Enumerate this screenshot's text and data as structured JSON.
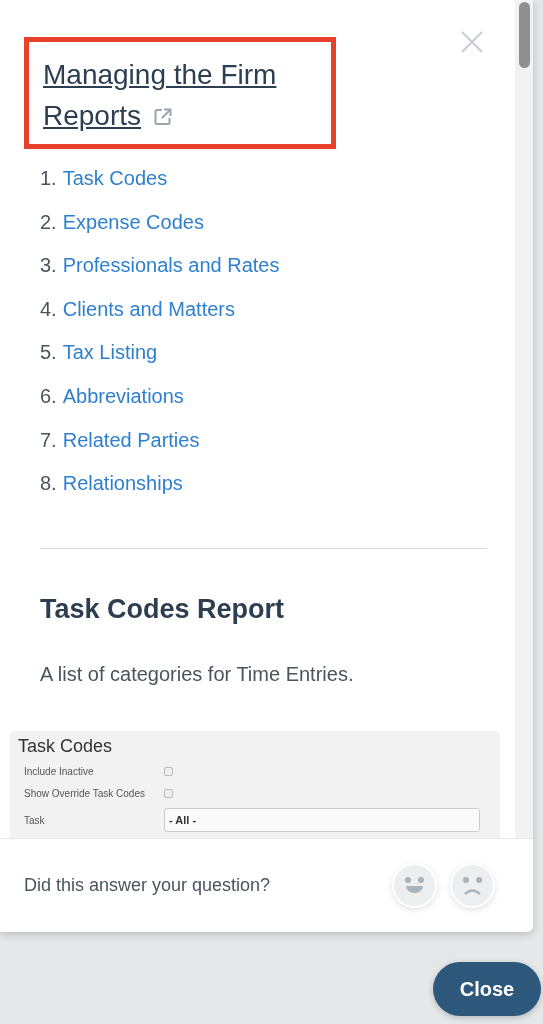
{
  "article": {
    "title": "Managing the Firm Reports",
    "highlighted": true,
    "contents": [
      {
        "number": "1.",
        "label": "Task Codes"
      },
      {
        "number": "2.",
        "label": "Expense Codes"
      },
      {
        "number": "3.",
        "label": "Professionals and Rates"
      },
      {
        "number": "4.",
        "label": "Clients and Matters"
      },
      {
        "number": "5.",
        "label": "Tax Listing"
      },
      {
        "number": "6.",
        "label": "Abbreviations"
      },
      {
        "number": "7.",
        "label": "Related Parties"
      },
      {
        "number": "8.",
        "label": "Relationships"
      }
    ],
    "section_heading": "Task Codes Report",
    "description": "A list of categories for Time Entries.",
    "screenshot": {
      "title": "Task Codes",
      "fields": [
        {
          "label": "Include Inactive",
          "kind": "checkbox",
          "checked": false
        },
        {
          "label": "Show Override Task Codes",
          "kind": "checkbox",
          "checked": false
        },
        {
          "label": "Task",
          "kind": "select",
          "value": "- All -"
        }
      ]
    }
  },
  "feedback": {
    "question": "Did this answer your question?"
  },
  "close_button": "Close"
}
